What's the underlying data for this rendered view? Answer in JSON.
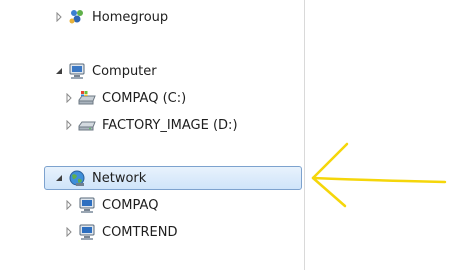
{
  "nav_tree": {
    "items": [
      {
        "label": "Homegroup",
        "icon": "homegroup-icon",
        "expander": "collapsed"
      },
      {
        "label": "Computer",
        "icon": "computer-icon",
        "expander": "expanded"
      },
      {
        "label": "COMPAQ (C:)",
        "icon": "system-drive-icon",
        "expander": "collapsed"
      },
      {
        "label": "FACTORY_IMAGE (D:)",
        "icon": "drive-icon",
        "expander": "collapsed"
      },
      {
        "label": "Network",
        "icon": "network-icon",
        "expander": "expanded",
        "selected": true
      },
      {
        "label": "COMPAQ",
        "icon": "network-computer-icon",
        "expander": "collapsed"
      },
      {
        "label": "COMTREND",
        "icon": "network-computer-icon",
        "expander": "collapsed"
      }
    ]
  },
  "annotation": {
    "color": "#f5d60a",
    "icon": "yellow-arrow-pointing-left"
  }
}
